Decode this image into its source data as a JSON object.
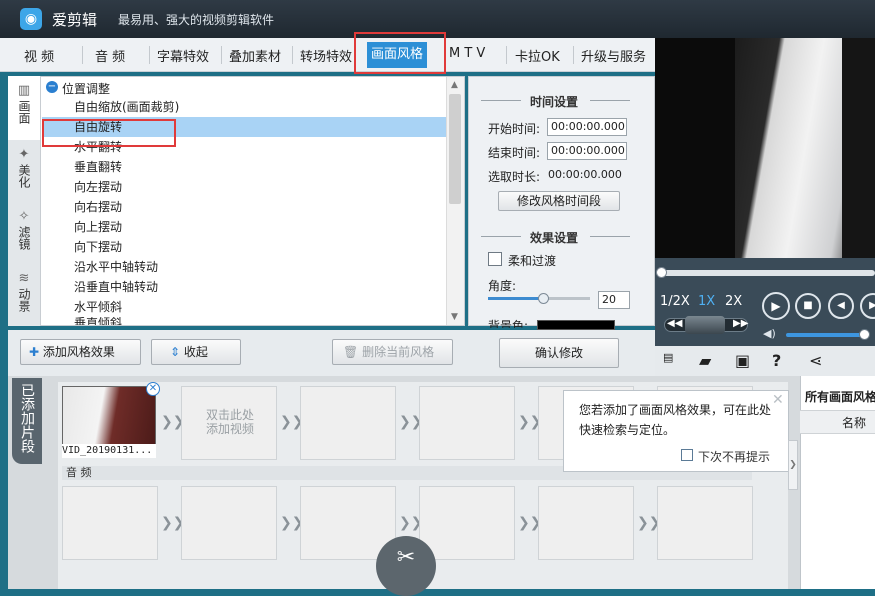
{
  "app": {
    "title": "爱剪辑",
    "slogan": "最易用、强大的视频剪辑软件",
    "logo_icon": "camera-lens-icon"
  },
  "menu": {
    "items": [
      "视 频",
      "音 频",
      "字幕特效",
      "叠加素材",
      "转场特效",
      "画面风格",
      "M T V",
      "卡拉OK",
      "升级与服务"
    ],
    "active_index": 5,
    "accent_color": "#2c8fd6"
  },
  "side_tabs": [
    {
      "label": "画面",
      "icon": "frame-icon"
    },
    {
      "label": "美化",
      "icon": "beautify-icon"
    },
    {
      "label": "滤镜",
      "icon": "filter-icon"
    },
    {
      "label": "动景",
      "icon": "motion-icon"
    }
  ],
  "effects": {
    "category": "位置调整",
    "items": [
      "自由缩放(画面裁剪)",
      "自由旋转",
      "水平翻转",
      "垂直翻转",
      "向左摆动",
      "向右摆动",
      "向上摆动",
      "向下摆动",
      "沿水平中轴转动",
      "沿垂直中轴转动",
      "水平倾斜",
      "垂直倾斜"
    ],
    "selected_index": 1
  },
  "time_settings": {
    "title": "时间设置",
    "start_label": "开始时间:",
    "start_value": "00:00:00.000",
    "end_label": "结束时间:",
    "end_value": "00:00:00.000",
    "duration_label": "选取时长:",
    "duration_value": "00:00:00.000",
    "modify_button": "修改风格时间段"
  },
  "effect_settings": {
    "title": "效果设置",
    "soft_transition_label": "柔和过渡",
    "soft_transition_checked": false,
    "angle_label": "角度:",
    "angle_value": "20",
    "bg_color_label": "背景色:",
    "bg_color": "#000000"
  },
  "actions": {
    "add_effect": "添加风格效果",
    "collapse": "收起",
    "delete_effect": "删除当前风格",
    "confirm": "确认修改"
  },
  "player": {
    "speeds": [
      "1/2X",
      "1X",
      "2X"
    ],
    "active_speed": "1X"
  },
  "timeline": {
    "tab_label": "已添加片段",
    "first_clip_name": "VID_20190131...",
    "add_video_hint": "双击此处\n添加视频",
    "audio_label": "音 频"
  },
  "tooltip": {
    "text": "您若添加了画面风格效果，可在此处快速检索与定位。",
    "dont_show_label": "下次不再提示"
  },
  "right_panel": {
    "title": "所有画面风格",
    "column_name": "名称"
  }
}
